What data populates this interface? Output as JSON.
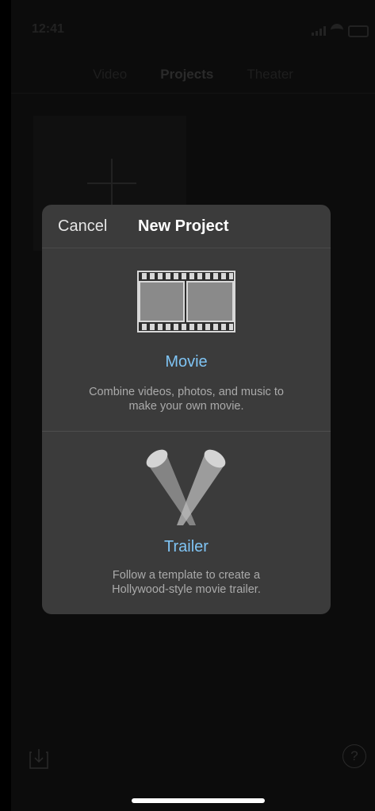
{
  "status_bar": {
    "time": "12:41"
  },
  "tabs": [
    "Video",
    "Projects",
    "Theater"
  ],
  "dialog": {
    "cancel_label": "Cancel",
    "title": "New Project",
    "options": [
      {
        "label": "Movie",
        "description": "Combine videos, photos, and music to make your own movie.",
        "icon": "film-strip-icon"
      },
      {
        "label": "Trailer",
        "description": "Follow a template to create a Hollywood-style movie trailer.",
        "icon": "spotlights-icon"
      }
    ]
  },
  "bottom_bar": {
    "import_icon": "import-icon",
    "help_glyph": "?"
  },
  "colors": {
    "accent": "#7fc4f4",
    "dialog_bg": "#3b3b3b",
    "background": "#0c0c0c"
  }
}
